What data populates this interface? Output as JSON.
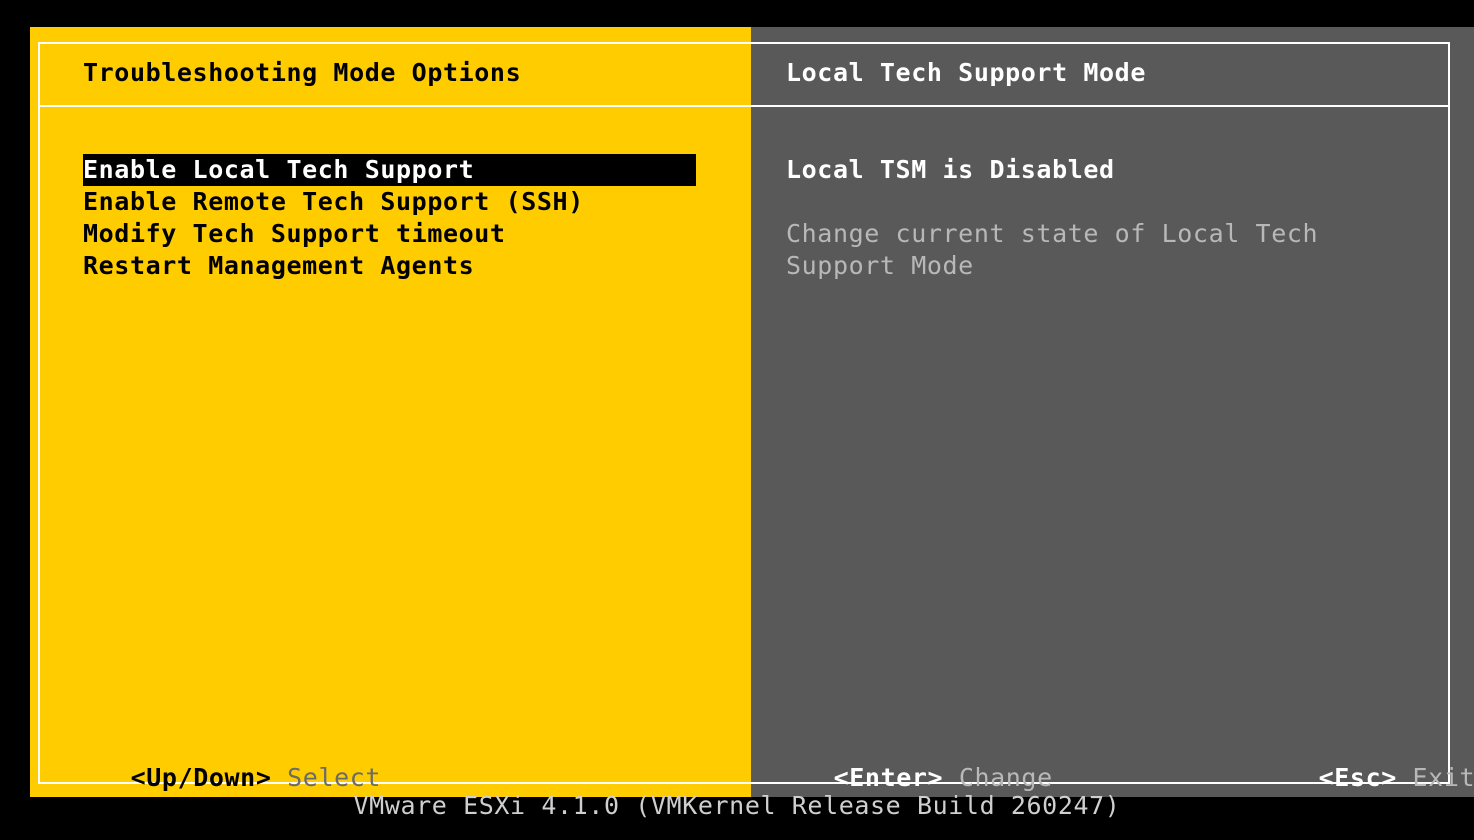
{
  "left_panel": {
    "title": "Troubleshooting Mode Options",
    "menu_items": [
      {
        "label": "Enable Local Tech Support",
        "selected": true
      },
      {
        "label": "Enable Remote Tech Support (SSH)",
        "selected": false
      },
      {
        "label": "Modify Tech Support timeout",
        "selected": false
      },
      {
        "label": "Restart Management Agents",
        "selected": false
      }
    ],
    "hint_key": "<Up/Down>",
    "hint_action": "Select"
  },
  "right_panel": {
    "title": "Local Tech Support Mode",
    "status": "Local TSM is Disabled",
    "description_line1": "Change current state of Local Tech",
    "description_line2": "Support Mode",
    "enter_key": "<Enter>",
    "enter_action": "Change",
    "esc_key": "<Esc>",
    "esc_action": "Exit"
  },
  "footer": {
    "version": "VMware ESXi 4.1.0 (VMKernel Release Build 260247)"
  },
  "colors": {
    "left_background": "#ffcc00",
    "right_background": "#595959",
    "screen_background": "#000000"
  }
}
